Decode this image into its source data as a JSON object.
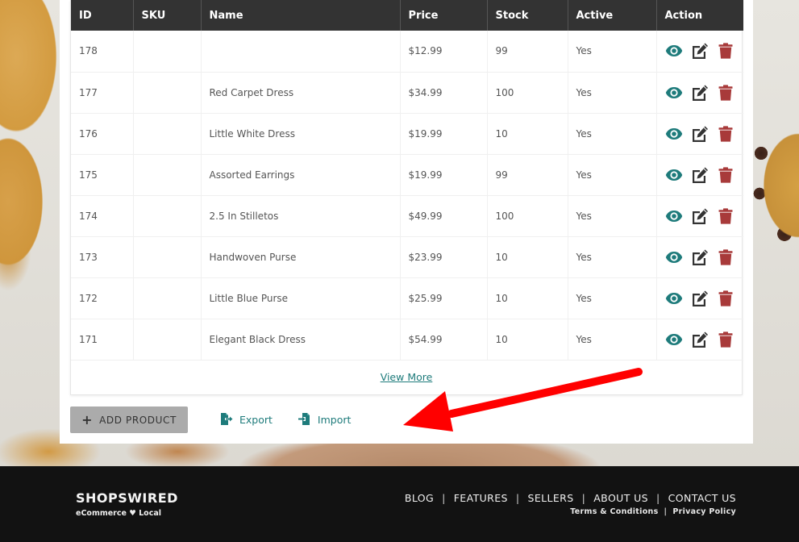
{
  "colors": {
    "accent": "#1e7b7b",
    "delete": "#a83a3a",
    "edit": "#333333",
    "table_header_bg": "#333333",
    "footer_bg": "#121212",
    "annotation_arrow": "#ff0000"
  },
  "table": {
    "columns": [
      "ID",
      "SKU",
      "Name",
      "Price",
      "Stock",
      "Active",
      "Action"
    ],
    "rows": [
      {
        "id": "178",
        "sku": "",
        "name": "",
        "price": "$12.99",
        "stock": "99",
        "active": "Yes"
      },
      {
        "id": "177",
        "sku": "",
        "name": "Red Carpet Dress",
        "price": "$34.99",
        "stock": "100",
        "active": "Yes"
      },
      {
        "id": "176",
        "sku": "",
        "name": "Little White Dress",
        "price": "$19.99",
        "stock": "10",
        "active": "Yes"
      },
      {
        "id": "175",
        "sku": "",
        "name": "Assorted Earrings",
        "price": "$19.99",
        "stock": "99",
        "active": "Yes"
      },
      {
        "id": "174",
        "sku": "",
        "name": "2.5 In Stilletos",
        "price": "$49.99",
        "stock": "100",
        "active": "Yes"
      },
      {
        "id": "173",
        "sku": "",
        "name": "Handwoven Purse",
        "price": "$23.99",
        "stock": "10",
        "active": "Yes"
      },
      {
        "id": "172",
        "sku": "",
        "name": "Little Blue Purse",
        "price": "$25.99",
        "stock": "10",
        "active": "Yes"
      },
      {
        "id": "171",
        "sku": "",
        "name": "Elegant Black Dress",
        "price": "$54.99",
        "stock": "10",
        "active": "Yes"
      }
    ],
    "action_icons": [
      "eye-icon",
      "edit-icon",
      "trash-icon"
    ],
    "view_more": "View More"
  },
  "toolbar": {
    "add_product": "ADD PRODUCT",
    "add_icon": "plus-icon",
    "export": "Export",
    "export_icon": "file-export-icon",
    "import": "Import",
    "import_icon": "file-import-icon"
  },
  "annotation": {
    "type": "red-arrow",
    "points_to": "Import"
  },
  "footer": {
    "brand": "SHOPSWIRED",
    "tagline_left": "eCommerce",
    "tagline_icon": "heart-icon",
    "tagline_right": "Local",
    "nav": [
      "BLOG",
      "FEATURES",
      "SELLERS",
      "ABOUT US",
      "CONTACT US"
    ],
    "separator": "|",
    "legal": [
      "Terms & Conditions",
      "Privacy Policy"
    ]
  }
}
